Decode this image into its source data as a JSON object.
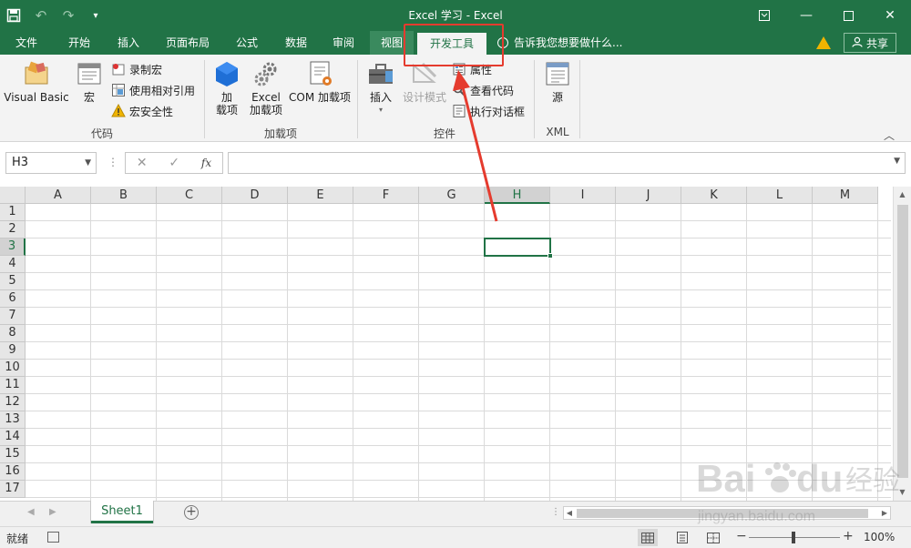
{
  "window": {
    "title": "Excel 学习 - Excel"
  },
  "ribbon_tabs": [
    {
      "label": "文件"
    },
    {
      "label": "开始"
    },
    {
      "label": "插入"
    },
    {
      "label": "页面布局"
    },
    {
      "label": "公式"
    },
    {
      "label": "数据"
    },
    {
      "label": "审阅"
    },
    {
      "label": "视图"
    },
    {
      "label": "开发工具"
    }
  ],
  "active_tab": "开发工具",
  "tell_me": "告诉我您想要做什么...",
  "share": "共享",
  "groups": {
    "code": {
      "label": "代码",
      "visual_basic": "Visual Basic",
      "macros": "宏",
      "record_macro": "录制宏",
      "relative_refs": "使用相对引用",
      "macro_security": "宏安全性"
    },
    "addins": {
      "label": "加载项",
      "addins_line1": "加",
      "addins_line2": "载项",
      "excel_addins_line1": "Excel",
      "excel_addins_line2": "加载项",
      "com_addins": "COM 加载项"
    },
    "controls": {
      "label": "控件",
      "insert": "插入",
      "design_mode": "设计模式",
      "properties": "属性",
      "view_code": "查看代码",
      "run_dialog": "执行对话框"
    },
    "xml": {
      "label": "XML",
      "source": "源"
    }
  },
  "formula_bar": {
    "name_box": "H3",
    "fx": "fx",
    "formula": ""
  },
  "columns": [
    "A",
    "B",
    "C",
    "D",
    "E",
    "F",
    "G",
    "H",
    "I",
    "J",
    "K",
    "L",
    "M"
  ],
  "rows": [
    "1",
    "2",
    "3",
    "4",
    "5",
    "6",
    "7",
    "8",
    "9",
    "10",
    "11",
    "12",
    "13",
    "14",
    "15",
    "16",
    "17"
  ],
  "selected_cell": {
    "col": "H",
    "row": "3"
  },
  "sheets": [
    {
      "name": "Sheet1"
    }
  ],
  "status": {
    "ready": "就绪",
    "zoom": "100%"
  },
  "colors": {
    "excel_green": "#217346",
    "annotation_red": "#e53b2e"
  }
}
